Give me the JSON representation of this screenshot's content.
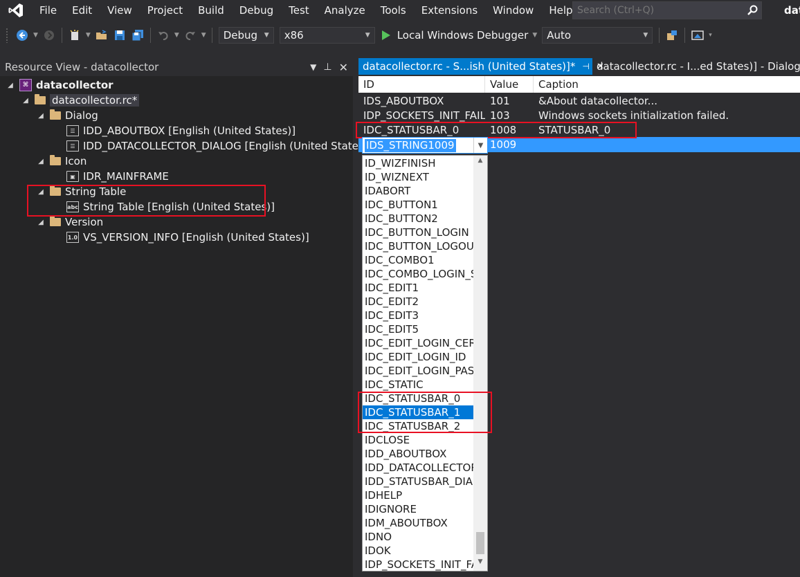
{
  "menu": {
    "items": [
      "File",
      "Edit",
      "View",
      "Project",
      "Build",
      "Debug",
      "Test",
      "Analyze",
      "Tools",
      "Extensions",
      "Window",
      "Help"
    ],
    "search_placeholder": "Search (Ctrl+Q)",
    "user_label": "dat"
  },
  "toolbar": {
    "config": "Debug",
    "platform": "x86",
    "run_label": "Local Windows Debugger",
    "run_mode": "Auto"
  },
  "resource_view": {
    "title": "Resource View - datacollector",
    "root": "datacollector",
    "rc_file": "datacollector.rc*",
    "folders": [
      {
        "name": "Dialog",
        "items": [
          "IDD_ABOUTBOX [English (United States)]",
          "IDD_DATACOLLECTOR_DIALOG [English (United States)]"
        ]
      },
      {
        "name": "Icon",
        "items": [
          "IDR_MAINFRAME"
        ]
      },
      {
        "name": "String Table",
        "items": [
          "String Table [English (United States)]"
        ]
      },
      {
        "name": "Version",
        "items": [
          "VS_VERSION_INFO [English (United States)]"
        ]
      }
    ]
  },
  "tabs": {
    "active": "datacollector.rc - S...ish (United States)]*",
    "inactive": "datacollector.rc - I...ed States)] - Dialog*"
  },
  "string_table": {
    "columns": [
      "ID",
      "Value",
      "Caption"
    ],
    "rows": [
      {
        "id": "IDS_ABOUTBOX",
        "value": "101",
        "caption": "&About datacollector..."
      },
      {
        "id": "IDP_SOCKETS_INIT_FAIL...",
        "value": "103",
        "caption": "Windows sockets initialization failed."
      },
      {
        "id": "IDC_STATUSBAR_0",
        "value": "1008",
        "caption": "STATUSBAR_0"
      }
    ],
    "editing": {
      "id": "IDS_STRING1009",
      "value": "1009"
    }
  },
  "id_dropdown": {
    "items": [
      "ID_WIZFINISH",
      "ID_WIZNEXT",
      "IDABORT",
      "IDC_BUTTON1",
      "IDC_BUTTON2",
      "IDC_BUTTON_LOGIN",
      "IDC_BUTTON_LOGOUT",
      "IDC_COMBO1",
      "IDC_COMBO_LOGIN_SE",
      "IDC_EDIT1",
      "IDC_EDIT2",
      "IDC_EDIT3",
      "IDC_EDIT5",
      "IDC_EDIT_LOGIN_CERT",
      "IDC_EDIT_LOGIN_ID",
      "IDC_EDIT_LOGIN_PASSV",
      "IDC_STATIC",
      "IDC_STATUSBAR_0",
      "IDC_STATUSBAR_1",
      "IDC_STATUSBAR_2",
      "IDCLOSE",
      "IDD_ABOUTBOX",
      "IDD_DATACOLLECTOR_",
      "IDD_STATUSBAR_DIALO",
      "IDHELP",
      "IDIGNORE",
      "IDM_ABOUTBOX",
      "IDNO",
      "IDOK",
      "IDP_SOCKETS_INIT_FAIL"
    ],
    "selected": "IDC_STATUSBAR_1"
  },
  "colors": {
    "accent": "#007acc",
    "highlight": "#e81123",
    "selection": "#3399ff"
  }
}
